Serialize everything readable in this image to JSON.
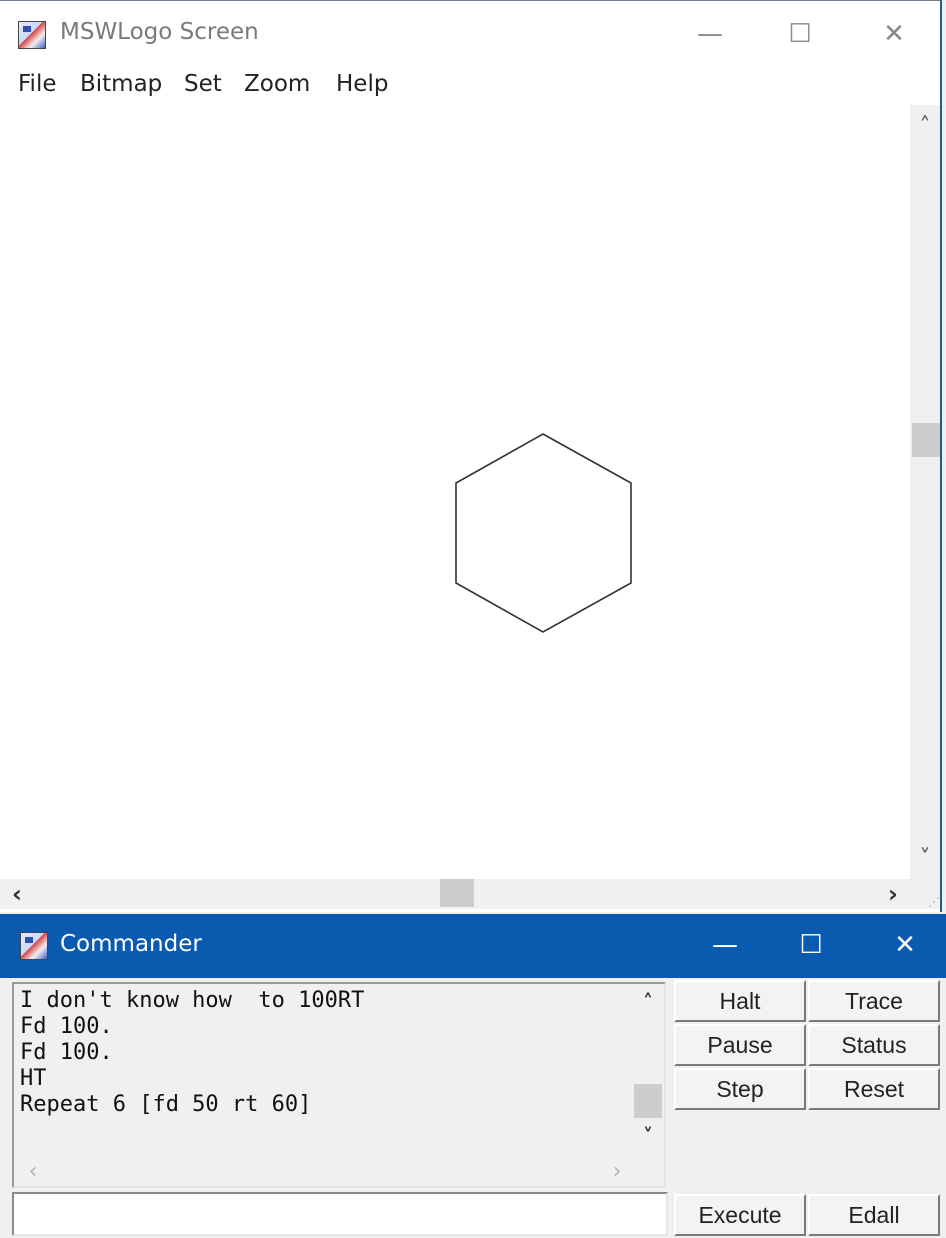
{
  "logo_window": {
    "title": "MSWLogo Screen",
    "menu": [
      "File",
      "Bitmap",
      "Set",
      "Zoom",
      "Help"
    ],
    "controls": {
      "minimize": "—",
      "maximize": "☐",
      "close": "✕"
    },
    "drawing": {
      "shape": "hexagon",
      "stroke_color": "#333333"
    }
  },
  "commander": {
    "title": "Commander",
    "controls": {
      "minimize": "—",
      "maximize": "☐",
      "close": "✕"
    },
    "history": [
      "I don't know how  to 100RT",
      "Fd 100.",
      "Fd 100.",
      "HT",
      "Repeat 6 [fd 50 rt 60]"
    ],
    "buttons": {
      "halt": "Halt",
      "trace": "Trace",
      "pause": "Pause",
      "status": "Status",
      "step": "Step",
      "reset": "Reset",
      "execute": "Execute",
      "edall": "Edall"
    },
    "input_value": ""
  },
  "colors": {
    "commander_titlebar": "#0a5bb0",
    "canvas_background": "#ffffff"
  }
}
